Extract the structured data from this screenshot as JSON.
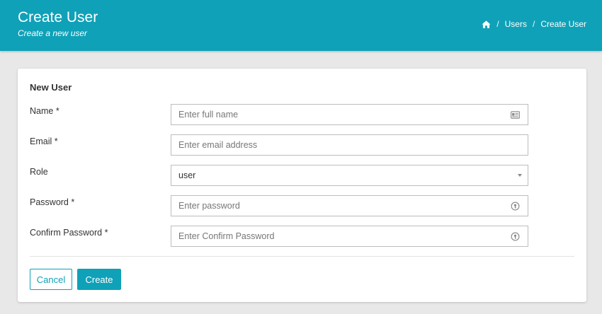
{
  "header": {
    "title": "Create User",
    "subtitle": "Create a new user",
    "breadcrumb": {
      "home_icon": "home-icon",
      "separator": "/",
      "items": [
        "Users",
        "Create User"
      ]
    }
  },
  "form": {
    "title": "New User",
    "fields": {
      "name": {
        "label": "Name *",
        "placeholder": "Enter full name",
        "icon": "id-card-icon"
      },
      "email": {
        "label": "Email *",
        "placeholder": "Enter email address"
      },
      "role": {
        "label": "Role",
        "value": "user"
      },
      "password": {
        "label": "Password *",
        "placeholder": "Enter password",
        "icon": "password-key-icon"
      },
      "confirm_password": {
        "label": "Confirm Password *",
        "placeholder": "Enter Confirm Password",
        "icon": "password-key-icon"
      }
    },
    "buttons": {
      "cancel": "Cancel",
      "create": "Create"
    }
  },
  "colors": {
    "accent": "#0fa1b8",
    "background": "#e8e8e8",
    "card": "#ffffff"
  }
}
